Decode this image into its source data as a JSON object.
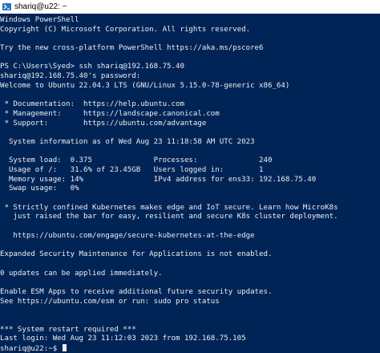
{
  "window": {
    "title": "shariq@u22: ~",
    "icon": "powershell-icon",
    "background": "#012456",
    "foreground": "#eeedf0"
  },
  "terminal": {
    "lines": [
      "Windows PowerShell",
      "Copyright (C) Microsoft Corporation. All rights reserved.",
      "",
      "Try the new cross-platform PowerShell https://aka.ms/pscore6",
      "",
      "PS C:\\Users\\Syed> ssh shariq@192.168.75.40",
      "shariq@192.168.75.40's password:",
      "Welcome to Ubuntu 22.04.3 LTS (GNU/Linux 5.15.0-78-generic x86_64)",
      "",
      " * Documentation:  https://help.ubuntu.com",
      " * Management:     https://landscape.canonical.com",
      " * Support:        https://ubuntu.com/advantage",
      "",
      "  System information as of Wed Aug 23 11:18:58 AM UTC 2023",
      "",
      "  System load:  0.375              Processes:              240",
      "  Usage of /:   31.6% of 23.45GB   Users logged in:        1",
      "  Memory usage: 14%                IPv4 address for ens33: 192.168.75.40",
      "  Swap usage:   0%",
      "",
      " * Strictly confined Kubernetes makes edge and IoT secure. Learn how MicroK8s",
      "   just raised the bar for easy, resilient and secure K8s cluster deployment.",
      "",
      "   https://ubuntu.com/engage/secure-kubernetes-at-the-edge",
      "",
      "Expanded Security Maintenance for Applications is not enabled.",
      "",
      "0 updates can be applied immediately.",
      "",
      "Enable ESM Apps to receive additional future security updates.",
      "See https://ubuntu.com/esm or run: sudo pro status",
      "",
      "",
      "*** System restart required ***",
      "Last login: Wed Aug 23 11:12:03 2023 from 192.168.75.105",
      "shariq@u22:~$"
    ]
  }
}
